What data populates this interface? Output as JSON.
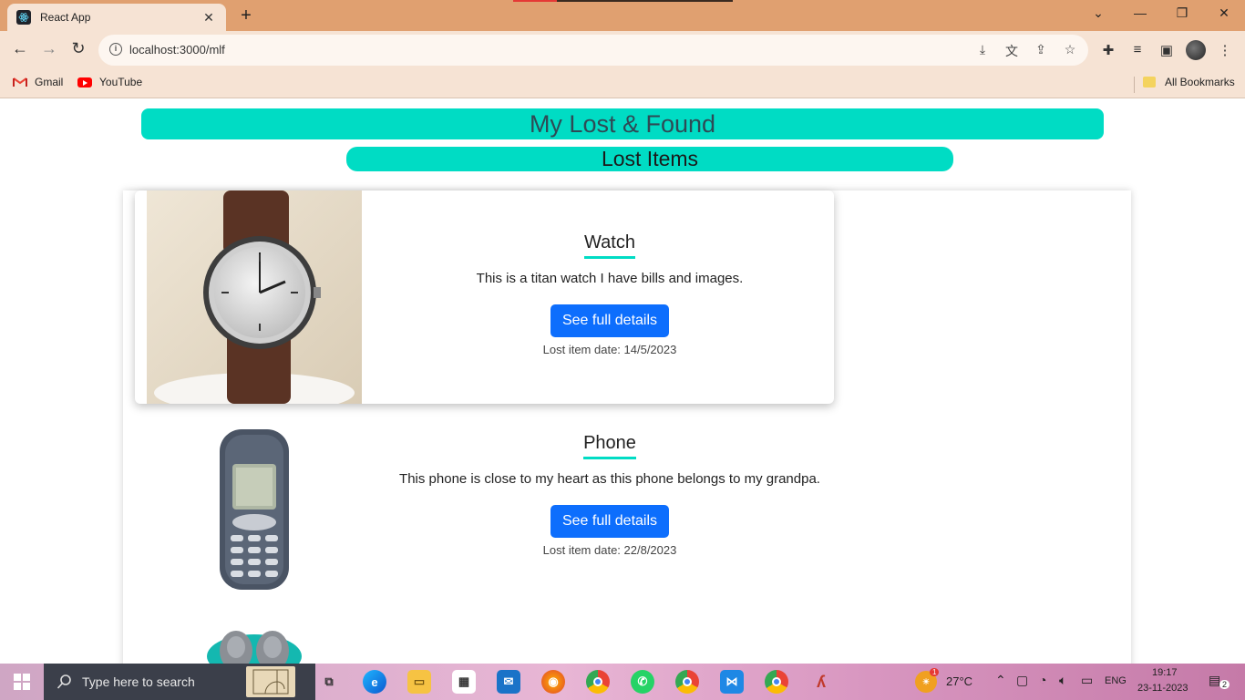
{
  "browser": {
    "tab_title": "React App",
    "url": "localhost:3000/mlf",
    "bookmarks": [
      "Gmail",
      "YouTube"
    ],
    "all_bookmarks": "All Bookmarks"
  },
  "page": {
    "title": "My Lost & Found",
    "subtitle": "Lost Items",
    "items": [
      {
        "name": "Watch",
        "description": "This is a titan watch I have bills and images.",
        "button": "See full details",
        "date": "Lost item date: 14/5/2023"
      },
      {
        "name": "Phone",
        "description": "This phone is close to my heart as this phone belongs to my grandpa.",
        "button": "See full details",
        "date": "Lost item date: 22/8/2023"
      }
    ]
  },
  "taskbar": {
    "search_placeholder": "Type here to search",
    "weather": "27°C",
    "language": "ENG",
    "time": "19:17",
    "date": "23-11-2023",
    "weather_badge": "1",
    "notification_count": "2"
  },
  "colors": {
    "accent": "#00dcc4",
    "button": "#0d6efd",
    "tabbar": "#e0a070"
  }
}
